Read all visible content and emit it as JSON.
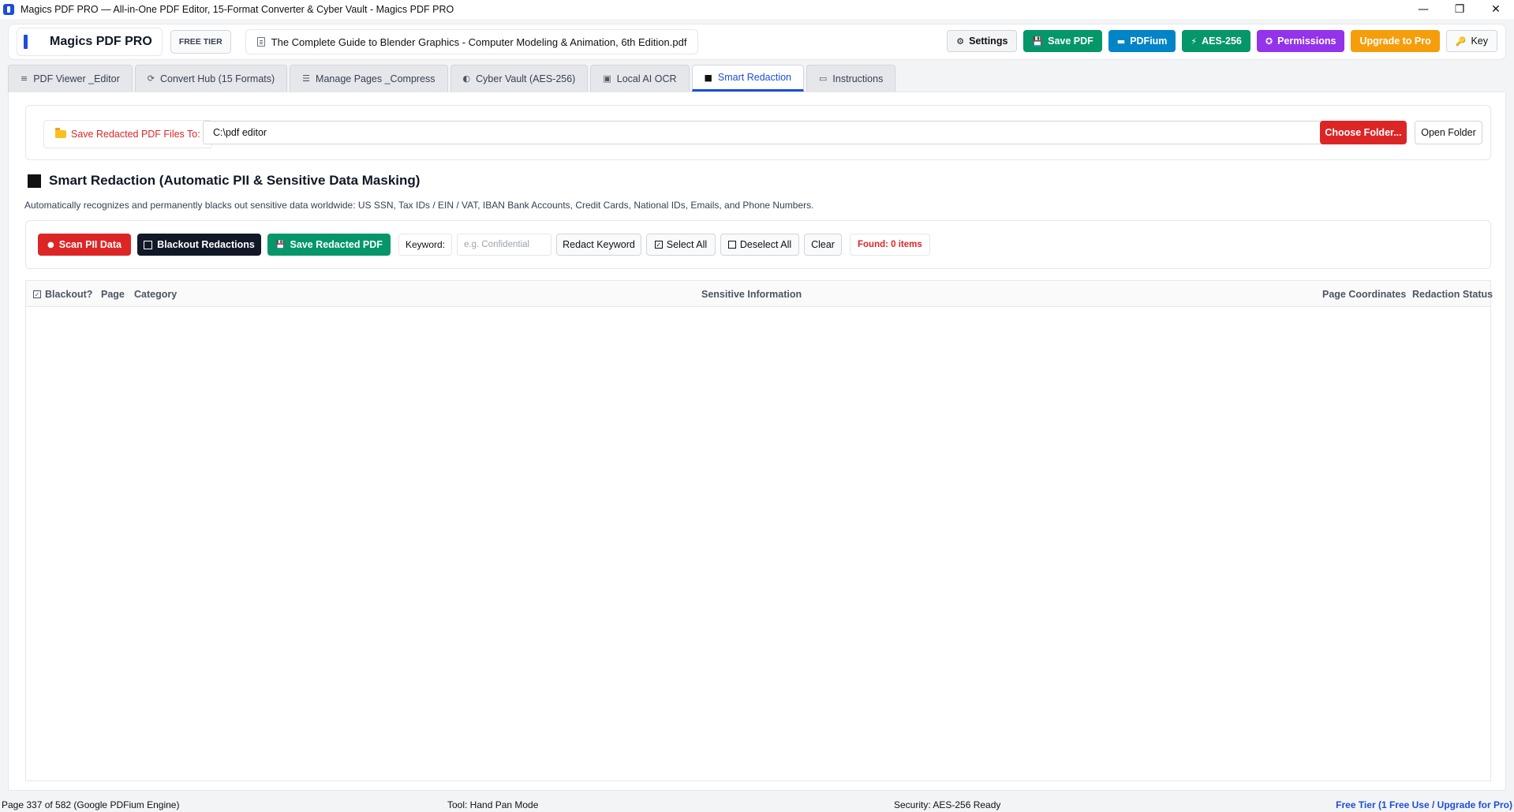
{
  "window": {
    "title": "Magics PDF PRO — All-in-One PDF Editor, 15-Format Converter & Cyber Vault - Magics PDF PRO",
    "controls": {
      "minimize": "—",
      "restore": "❐",
      "close": "✕"
    }
  },
  "header": {
    "brand": "Magics PDF PRO",
    "tier_badge": "FREE TIER",
    "file_name": "The Complete Guide to Blender Graphics - Computer Modeling & Animation, 6th Edition.pdf",
    "buttons": {
      "settings": "Settings",
      "save_pdf": "Save PDF",
      "pdfium": "PDFium",
      "aes": "AES-256",
      "permissions": "Permissions",
      "upgrade": "Upgrade to Pro",
      "key": "Key"
    },
    "icons": {
      "settings": "⚙",
      "save_pdf": "💾",
      "pdfium": "▬",
      "aes": "⚡",
      "permissions": "✪",
      "key": "🔑"
    }
  },
  "tabs": [
    {
      "label": "PDF Viewer _Editor",
      "icon": "≡"
    },
    {
      "label": "Convert Hub (15 Formats)",
      "icon": "⟳"
    },
    {
      "label": "Manage Pages _Compress",
      "icon": "☰"
    },
    {
      "label": "Cyber Vault (AES-256)",
      "icon": "◐"
    },
    {
      "label": "Local AI OCR",
      "icon": "▣"
    },
    {
      "label": "Smart Redaction",
      "icon": "■"
    },
    {
      "label": "Instructions",
      "icon": "▭"
    }
  ],
  "active_tab": "Smart Redaction",
  "folder": {
    "label": "Save Redacted PDF Files To:",
    "path": "C:\\pdf editor",
    "choose_button": "Choose Folder...",
    "open_button": "Open Folder"
  },
  "section": {
    "title": "Smart Redaction (Automatic PII & Sensitive Data Masking)",
    "description": "Automatically recognizes and permanently blacks out sensitive data worldwide: US SSN, Tax IDs / EIN / VAT, IBAN Bank Accounts, Credit Cards, National IDs, Emails, and Phone Numbers."
  },
  "toolbar": {
    "scan": "Scan PII Data",
    "blackout": "Blackout Redactions",
    "save_redacted": "Save Redacted PDF",
    "keyword_label": "Keyword:",
    "keyword_placeholder": "e.g. Confidential",
    "redact_keyword": "Redact Keyword",
    "select_all": "Select All",
    "deselect_all": "Deselect All",
    "clear": "Clear",
    "found": "Found: 0 items"
  },
  "table": {
    "columns": {
      "blackout": "Blackout?",
      "page": "Page",
      "category": "Category",
      "sensitive": "Sensitive Information",
      "coords": "Page Coordinates",
      "status": "Redaction Status"
    },
    "rows": []
  },
  "statusbar": {
    "page": "Page 337 of 582 (Google PDFium Engine)",
    "tool": "Tool: Hand Pan Mode",
    "security": "Security: AES-256 Ready",
    "tier": "Free Tier (1 Free Use / Upgrade for Pro)"
  },
  "colors": {
    "accent": "#1d4ed8",
    "danger": "#dc2626",
    "success": "#059669",
    "purple": "#9333ea",
    "amber": "#f59e0b"
  }
}
